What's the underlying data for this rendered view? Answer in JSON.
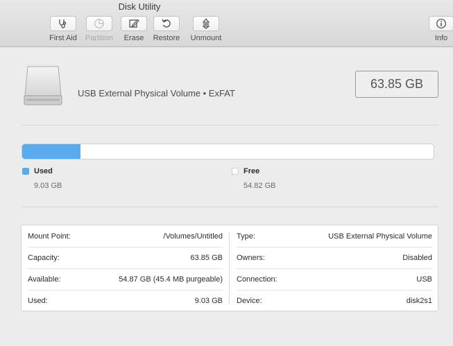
{
  "window": {
    "title": "Disk Utility"
  },
  "toolbar": {
    "first_aid": "First Aid",
    "partition": "Partition",
    "erase": "Erase",
    "restore": "Restore",
    "unmount": "Unmount",
    "info": "Info"
  },
  "volume": {
    "description": "USB External Physical Volume • ExFAT",
    "total_size": "63.85 GB",
    "used_fraction": 0.1414
  },
  "usage": {
    "used_label": "Used",
    "used_value": "9.03 GB",
    "used_color": "#5aabee",
    "free_label": "Free",
    "free_value": "54.82 GB",
    "free_color": "#ffffff"
  },
  "info": {
    "left": [
      {
        "label": "Mount Point:",
        "value": "/Volumes/Untitled"
      },
      {
        "label": "Capacity:",
        "value": "63.85 GB"
      },
      {
        "label": "Available:",
        "value": "54.87 GB (45.4 MB purgeable)"
      },
      {
        "label": "Used:",
        "value": "9.03 GB"
      }
    ],
    "right": [
      {
        "label": "Type:",
        "value": "USB External Physical Volume"
      },
      {
        "label": "Owners:",
        "value": "Disabled"
      },
      {
        "label": "Connection:",
        "value": "USB"
      },
      {
        "label": "Device:",
        "value": "disk2s1"
      }
    ]
  }
}
